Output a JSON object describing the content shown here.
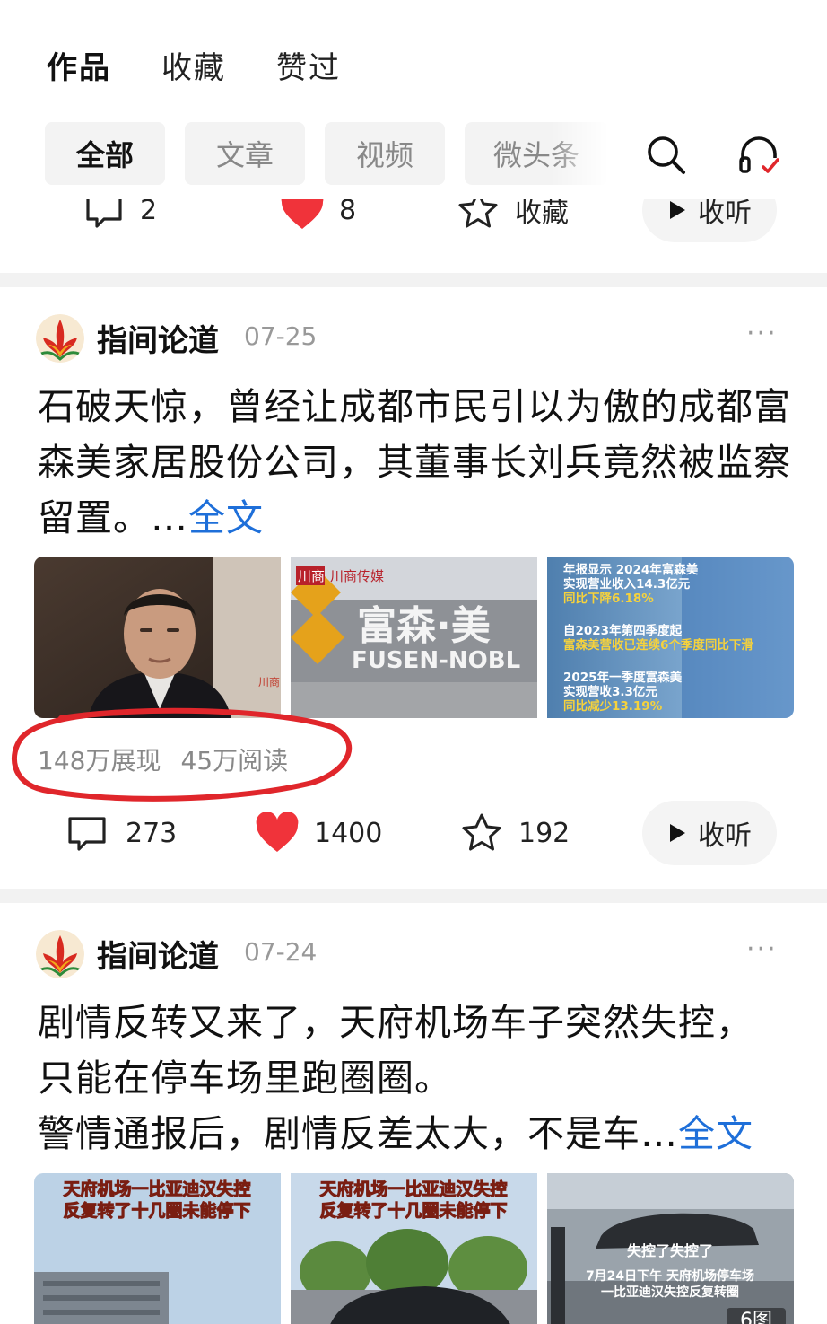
{
  "top_tabs": [
    {
      "label": "作品",
      "active": true
    },
    {
      "label": "收藏",
      "active": false
    },
    {
      "label": "赞过",
      "active": false
    }
  ],
  "filter_chips": [
    {
      "label": "全部",
      "active": true
    },
    {
      "label": "文章",
      "active": false
    },
    {
      "label": "视频",
      "active": false
    },
    {
      "label": "微头条",
      "active": false
    }
  ],
  "icons": {
    "search": "search-icon",
    "listen": "headphones-icon",
    "comment": "comment-icon",
    "like": "heart-icon",
    "favorite": "star-icon",
    "play": "play-icon",
    "more": "more-dots-icon"
  },
  "colors": {
    "accent_link": "#1e6fd9",
    "like_red": "#f0333a",
    "annotation_red": "#e0262b"
  },
  "previous_post_actions": {
    "comments": "2",
    "likes": "8",
    "favorite_label": "收藏",
    "listen_label": "收听"
  },
  "posts": [
    {
      "author": "指间论道",
      "date": "07-25",
      "more": "···",
      "text": "石破天惊，曾经让成都市民引以为傲的成都富森美家居股份公司，其董事长刘兵竟然被监察留置。…",
      "fulltext_label": "全文",
      "images": [
        {
          "caption_lines": [],
          "watermark": "川商"
        },
        {
          "logo": "川商",
          "brand": "川商传媒",
          "sign_cn": "富森·美",
          "sign_en": "FUSEN-NOBL"
        },
        {
          "caption_lines": [
            "年报显示 2024年富森美",
            "实现营业收入14.3亿元",
            "同比下降6.18%",
            "自2023年第四季度起",
            "富森美营收已连续6个季度同比下滑",
            "2025年一季度富森美",
            "实现营收3.3亿元",
            "同比减少13.19%"
          ]
        }
      ],
      "stats": {
        "impressions": "148万展现",
        "reads": "45万阅读"
      },
      "actions": {
        "comments": "273",
        "likes": "1400",
        "favorites": "192",
        "listen_label": "收听"
      }
    },
    {
      "author": "指间论道",
      "date": "07-24",
      "more": "···",
      "text_lines": [
        "剧情反转又来了，天府机场车子突然失控，",
        "只能在停车场里跑圈圈。",
        "警情通报后，剧情反差太大，不是车…"
      ],
      "fulltext_label": "全文",
      "images": [
        {
          "caption_lines": [
            "天府机场一比亚迪汉失控",
            "反复转了十几圈未能停下"
          ]
        },
        {
          "caption_lines": [
            "天府机场一比亚迪汉失控",
            "反复转了十几圈未能停下"
          ]
        },
        {
          "caption_lines": [
            "失控了失控了",
            "7月24日下午 天府机场停车场",
            "一比亚迪汉失控反复转圈"
          ],
          "count_badge": "6图"
        }
      ]
    }
  ]
}
